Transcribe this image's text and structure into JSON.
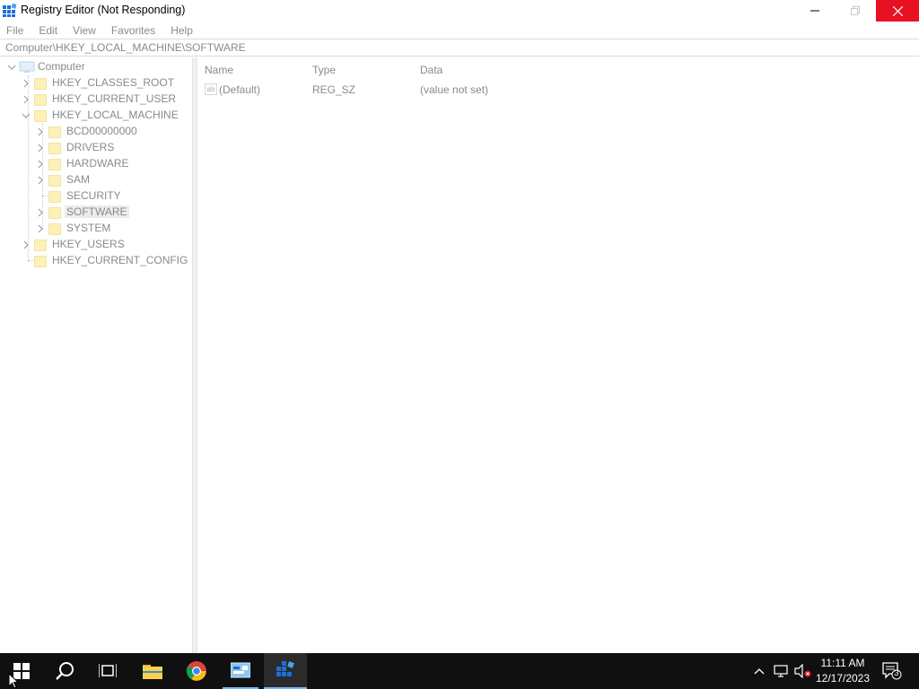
{
  "window": {
    "title": "Registry Editor (Not Responding)"
  },
  "menu": {
    "items": [
      "File",
      "Edit",
      "View",
      "Favorites",
      "Help"
    ]
  },
  "address": {
    "path": "Computer\\HKEY_LOCAL_MACHINE\\SOFTWARE"
  },
  "tree": {
    "root": "Computer",
    "hives": [
      "HKEY_CLASSES_ROOT",
      "HKEY_CURRENT_USER",
      "HKEY_LOCAL_MACHINE",
      "HKEY_USERS",
      "HKEY_CURRENT_CONFIG"
    ],
    "hklm_children": [
      "BCD00000000",
      "DRIVERS",
      "HARDWARE",
      "SAM",
      "SECURITY",
      "SOFTWARE",
      "SYSTEM"
    ],
    "selected": "SOFTWARE"
  },
  "list": {
    "columns": [
      "Name",
      "Type",
      "Data"
    ],
    "rows": [
      {
        "name": "(Default)",
        "type": "REG_SZ",
        "data": "(value not set)"
      }
    ]
  },
  "taskbar": {
    "apps": [
      "start-icon",
      "search-icon",
      "task-view-icon",
      "file-explorer-icon",
      "chrome-icon",
      "control-panel-icon",
      "registry-editor-icon"
    ],
    "time": "11:11 AM",
    "date": "12/17/2023",
    "notification_count": "3"
  },
  "colors": {
    "close_button": "#e81123",
    "taskbar": "#101010",
    "accent": "#76b9ed"
  }
}
